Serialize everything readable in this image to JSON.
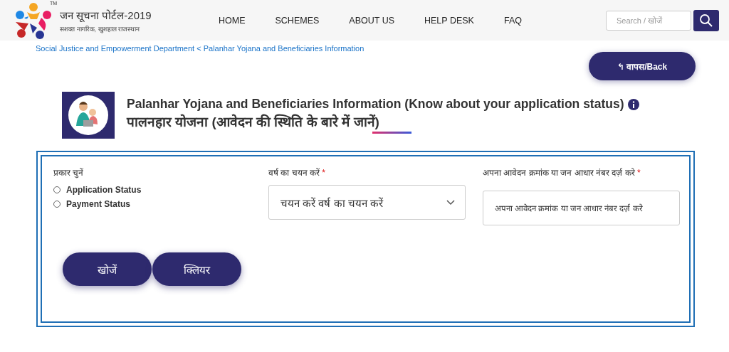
{
  "header": {
    "logo": {
      "title": "जन सूचना पोर्टल-2019",
      "tagline": "सशक्त नागरिक, खुशहाल राजस्थान",
      "mark": "TM"
    },
    "nav": [
      {
        "label": "HOME"
      },
      {
        "label": "SCHEMES"
      },
      {
        "label": "ABOUT US"
      },
      {
        "label": "HELP DESK"
      },
      {
        "label": "FAQ"
      }
    ],
    "search": {
      "placeholder": "Search / खोजें"
    }
  },
  "breadcrumb": "Social Justice and Empowerment Department < Palanhar Yojana and Beneficiaries Information",
  "back_button": {
    "icon": "↰",
    "label": "वापस/Back"
  },
  "title": {
    "english": "Palanhar Yojana and Beneficiaries Information (Know about your application status)",
    "hindi": "पालनहार योजना (आवेदन की स्थिति के बारे में जानें)"
  },
  "form": {
    "type_label": "प्रकार चुनें",
    "options": [
      {
        "label": "Application Status",
        "selected": false
      },
      {
        "label": "Payment Status",
        "selected": false
      }
    ],
    "year": {
      "label": "वर्ष का चयन करें",
      "required_mark": "*",
      "value": "चयन करें वर्ष का चयन करें"
    },
    "application": {
      "label": "अपना आवेदन क्रमांक या जन आधार नंबर दर्ज़ करे",
      "required_mark": "*",
      "placeholder": "अपना आवेदन क्रमांक या जन आधार नंबर दर्ज़ करे"
    },
    "buttons": [
      {
        "label": "खोजें"
      },
      {
        "label": "क्लियर"
      }
    ]
  }
}
